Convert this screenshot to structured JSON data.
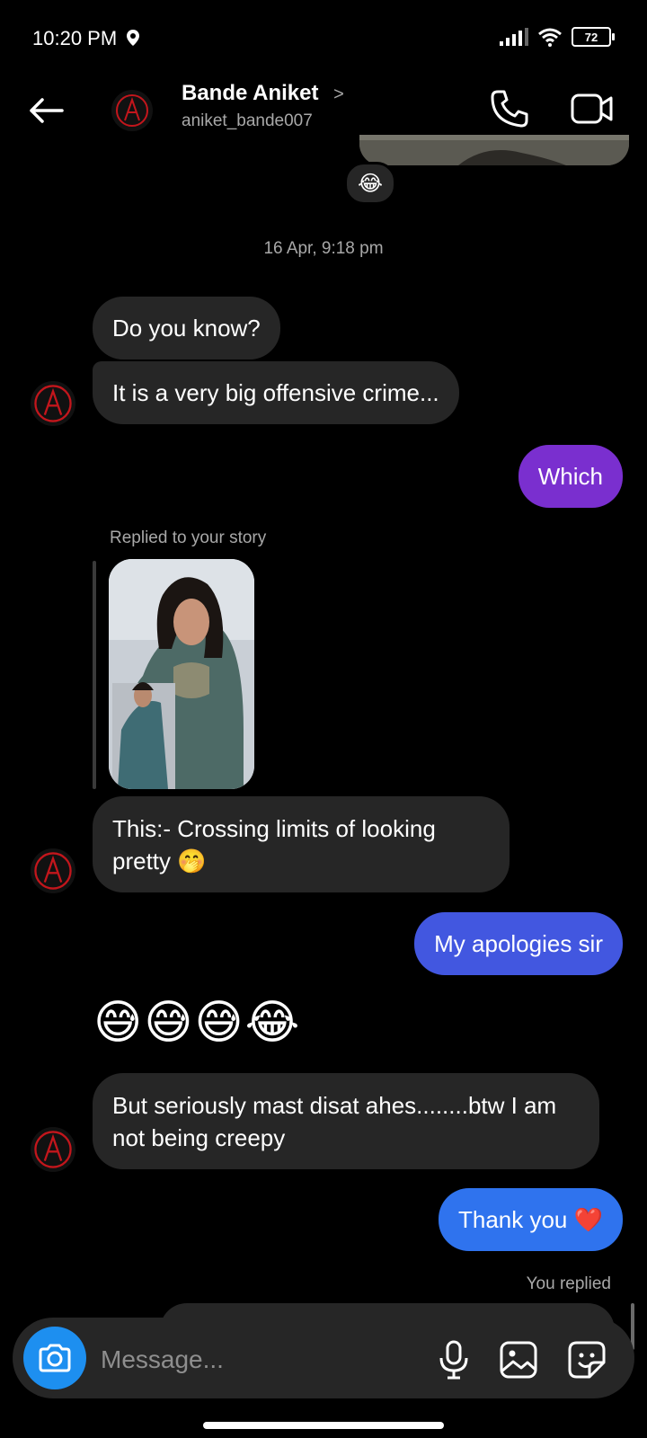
{
  "status": {
    "time": "10:20 PM",
    "battery": "72"
  },
  "header": {
    "name": "Bande Aniket",
    "chevron": ">",
    "username": "aniket_bande007"
  },
  "conversation": {
    "top_reaction": "😂",
    "timestamp": "16 Apr, 9:18 pm",
    "msg1": "Do you know?",
    "msg2": "It is a very big offensive crime...",
    "msg3": "Which",
    "replied_label": "Replied to your story",
    "msg4": "This:- Crossing limits of looking pretty 🤭",
    "msg5": "My apologies sir",
    "emoji_message": "😅😅😅😂",
    "msg6": "But seriously mast disat ahes........btw I am not being creepy",
    "msg7": "Thank you ❤️",
    "you_replied": "You replied"
  },
  "composer": {
    "placeholder": "Message..."
  },
  "colors": {
    "background": "#000000",
    "incoming_bubble": "#262626",
    "outgoing_purple": "#7a2fcf",
    "outgoing_blue": "#4257e0",
    "outgoing_blue_light": "#2f73ee",
    "camera_button": "#1d8ff0"
  },
  "icons": [
    "back-arrow-icon",
    "phone-icon",
    "video-call-icon",
    "camera-icon",
    "microphone-icon",
    "gallery-icon",
    "sticker-icon",
    "signal-icon",
    "wifi-icon",
    "battery-icon",
    "location-icon"
  ]
}
